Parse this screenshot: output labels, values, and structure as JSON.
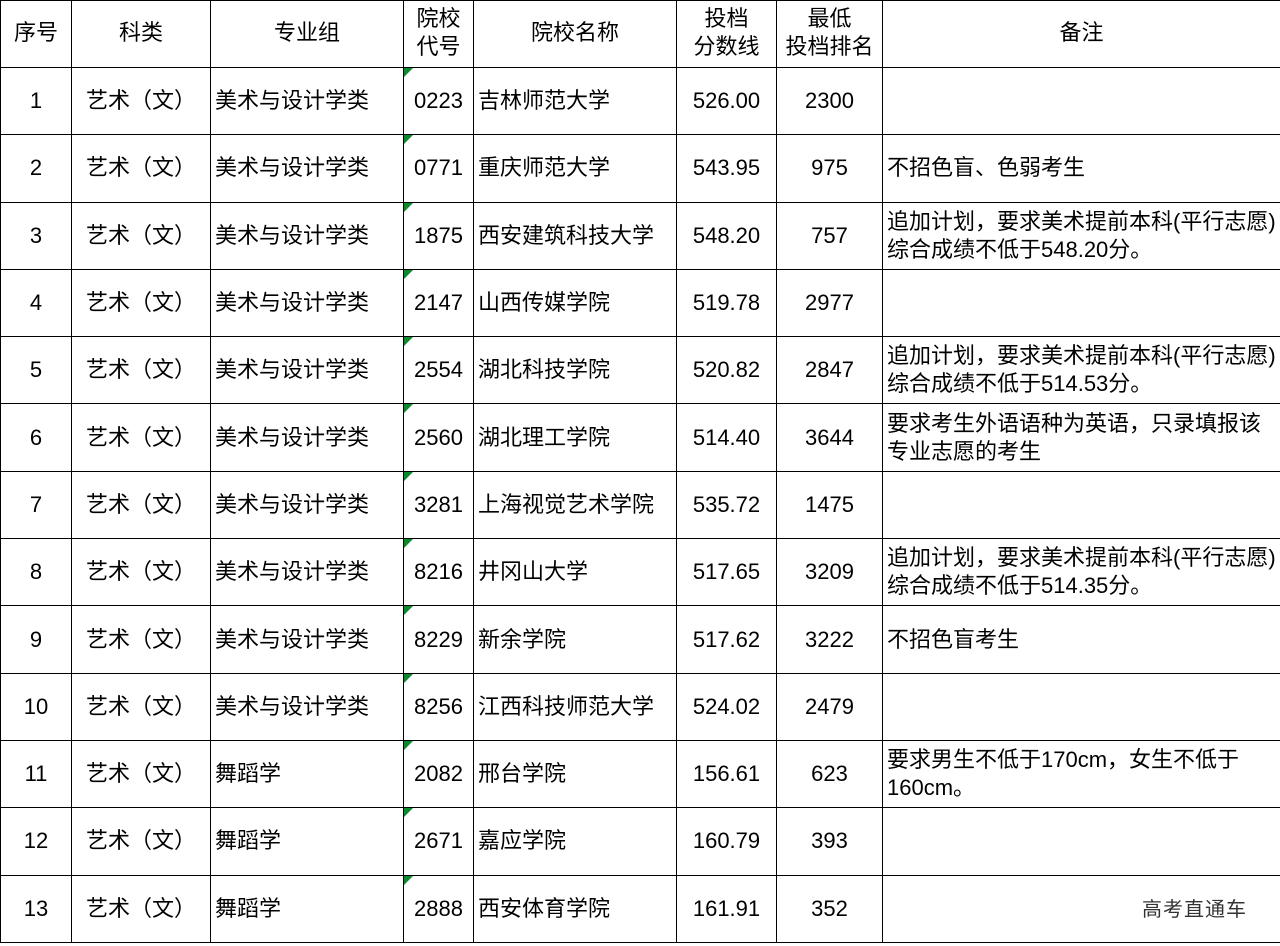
{
  "headers": {
    "seq": "序号",
    "category": "科类",
    "group": "专业组",
    "code_l1": "院校",
    "code_l2": "代号",
    "name": "院校名称",
    "score_l1": "投档",
    "score_l2": "分数线",
    "rank_l1": "最低",
    "rank_l2": "投档排名",
    "note": "备注"
  },
  "rows": [
    {
      "seq": "1",
      "category": "艺术（文）",
      "group": "美术与设计学类",
      "code": "0223",
      "name": "吉林师范大学",
      "score": "526.00",
      "rank": "2300",
      "note": ""
    },
    {
      "seq": "2",
      "category": "艺术（文）",
      "group": "美术与设计学类",
      "code": "0771",
      "name": "重庆师范大学",
      "score": "543.95",
      "rank": "975",
      "note": "不招色盲、色弱考生"
    },
    {
      "seq": "3",
      "category": "艺术（文）",
      "group": "美术与设计学类",
      "code": "1875",
      "name": "西安建筑科技大学",
      "score": "548.20",
      "rank": "757",
      "note": "追加计划，要求美术提前本科(平行志愿)综合成绩不低于548.20分。"
    },
    {
      "seq": "4",
      "category": "艺术（文）",
      "group": "美术与设计学类",
      "code": "2147",
      "name": "山西传媒学院",
      "score": "519.78",
      "rank": "2977",
      "note": ""
    },
    {
      "seq": "5",
      "category": "艺术（文）",
      "group": "美术与设计学类",
      "code": "2554",
      "name": "湖北科技学院",
      "score": "520.82",
      "rank": "2847",
      "note": "追加计划，要求美术提前本科(平行志愿)综合成绩不低于514.53分。"
    },
    {
      "seq": "6",
      "category": "艺术（文）",
      "group": "美术与设计学类",
      "code": "2560",
      "name": "湖北理工学院",
      "score": "514.40",
      "rank": "3644",
      "note": "要求考生外语语种为英语，只录填报该专业志愿的考生"
    },
    {
      "seq": "7",
      "category": "艺术（文）",
      "group": "美术与设计学类",
      "code": "3281",
      "name": "上海视觉艺术学院",
      "score": "535.72",
      "rank": "1475",
      "note": ""
    },
    {
      "seq": "8",
      "category": "艺术（文）",
      "group": "美术与设计学类",
      "code": "8216",
      "name": "井冈山大学",
      "score": "517.65",
      "rank": "3209",
      "note": "追加计划，要求美术提前本科(平行志愿)综合成绩不低于514.35分。"
    },
    {
      "seq": "9",
      "category": "艺术（文）",
      "group": "美术与设计学类",
      "code": "8229",
      "name": "新余学院",
      "score": "517.62",
      "rank": "3222",
      "note": "不招色盲考生"
    },
    {
      "seq": "10",
      "category": "艺术（文）",
      "group": "美术与设计学类",
      "code": "8256",
      "name": "江西科技师范大学",
      "score": "524.02",
      "rank": "2479",
      "note": ""
    },
    {
      "seq": "11",
      "category": "艺术（文）",
      "group": "舞蹈学",
      "code": "2082",
      "name": "邢台学院",
      "score": "156.61",
      "rank": "623",
      "note": "要求男生不低于170cm，女生不低于160cm。"
    },
    {
      "seq": "12",
      "category": "艺术（文）",
      "group": "舞蹈学",
      "code": "2671",
      "name": "嘉应学院",
      "score": "160.79",
      "rank": "393",
      "note": ""
    },
    {
      "seq": "13",
      "category": "艺术（文）",
      "group": "舞蹈学",
      "code": "2888",
      "name": "西安体育学院",
      "score": "161.91",
      "rank": "352",
      "note": ""
    }
  ],
  "watermark": "高考直通车",
  "colors": {
    "cell_marker": "#0b8a2d",
    "grid": "#000000",
    "background": "#ffffff"
  }
}
